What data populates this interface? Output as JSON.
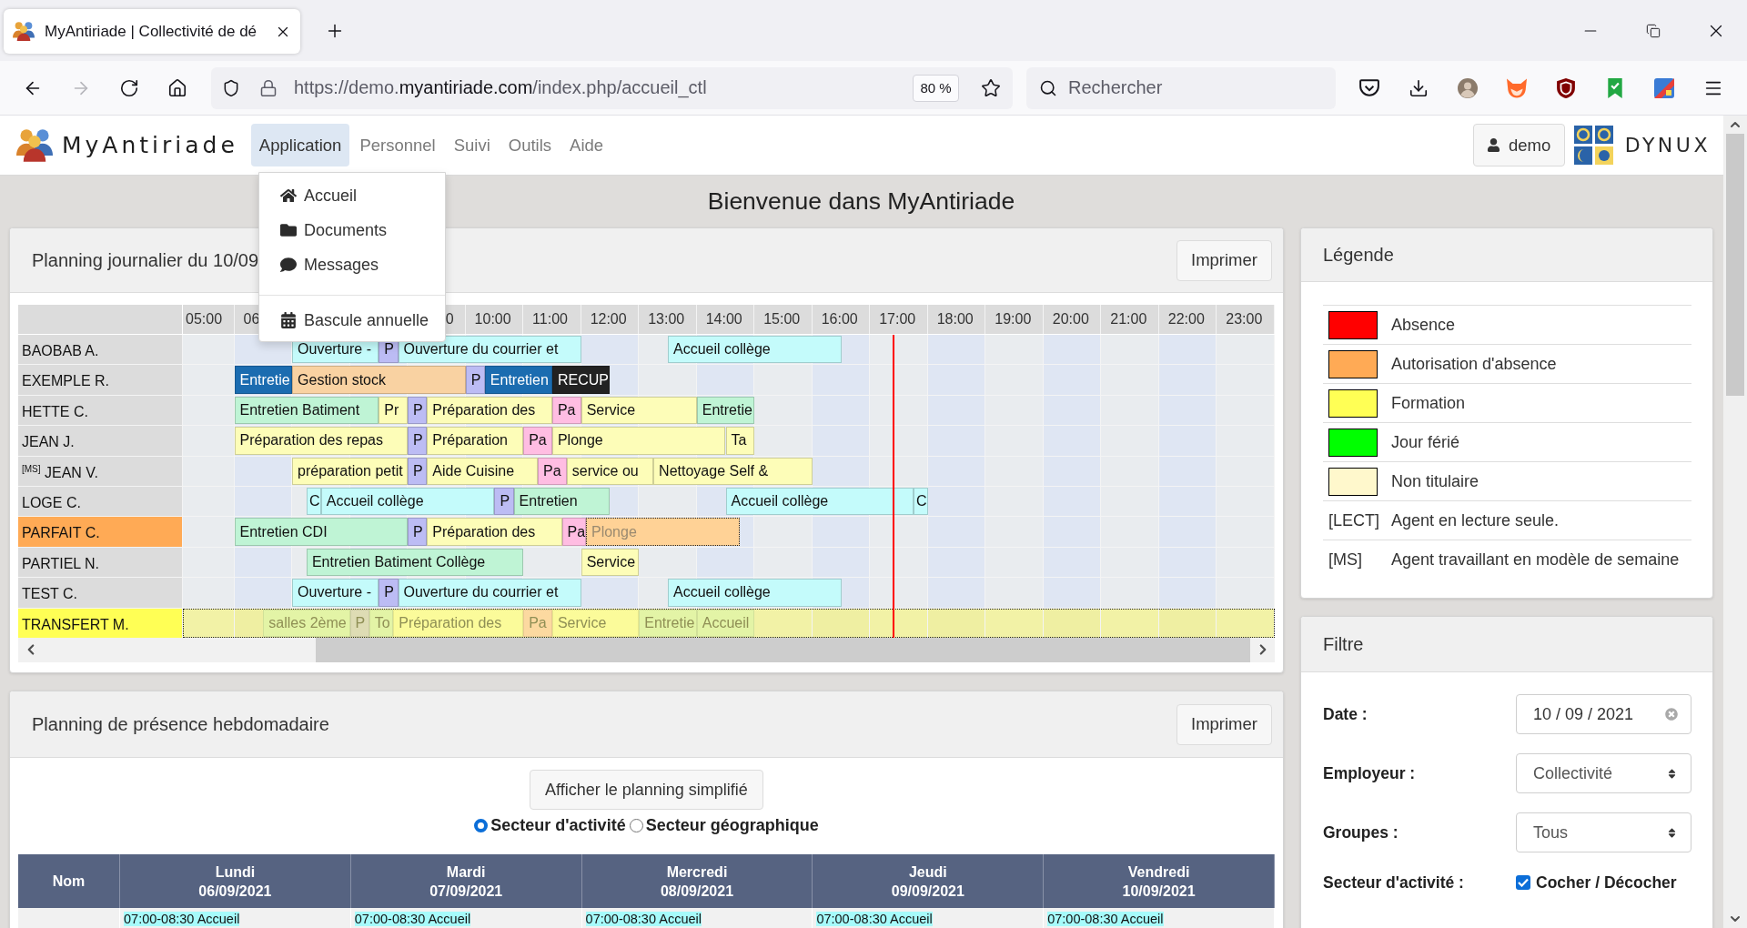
{
  "browser": {
    "tab": {
      "title": "MyAntiriade | Collectivité de dé",
      "selected": true
    },
    "history": {
      "back_disabled": false,
      "forward_disabled": true
    },
    "address": {
      "scheme": "https://demo.",
      "domain": "myantiriade.com",
      "path": "/index.php/accueil_ctl"
    },
    "zoom": "80 %",
    "search": {
      "placeholder": "Rechercher"
    }
  },
  "app": {
    "logo": "MyAntiriade",
    "menu": [
      {
        "label": "Application",
        "selected": true
      },
      {
        "label": "Personnel",
        "selected": false
      },
      {
        "label": "Suivi",
        "selected": false
      },
      {
        "label": "Outils",
        "selected": false
      },
      {
        "label": "Aide",
        "selected": false
      }
    ],
    "user": "demo",
    "partner_logo": "DYNUX",
    "dropdown": {
      "groups": [
        [
          {
            "label": "Accueil"
          },
          {
            "label": "Documents"
          },
          {
            "label": "Messages"
          }
        ],
        [
          {
            "label": "Bascule annuelle"
          }
        ]
      ]
    }
  },
  "heading": "Bienvenue dans MyAntiriade",
  "daily_planning": {
    "title": "Planning journalier du 10/09",
    "print_button": "Imprimer",
    "hour_labels": {
      "before_menu": [
        "05:00",
        "06"
      ],
      "after_menu": [
        "0",
        "10:00",
        "11:00",
        "12:00",
        "13:00",
        "14:00",
        "15:00",
        "16:00",
        "17:00",
        "18:00",
        "19:00",
        "20:00",
        "21:00",
        "22:00",
        "23:00"
      ]
    },
    "rows": [
      {
        "name": "BAOBAB A.",
        "faded": false,
        "events": [
          {
            "kind": "shift",
            "label": "Ouverture -",
            "color": "#c4fbfb"
          },
          {
            "kind": "shift",
            "label": "P",
            "color": "#bcbcf4"
          },
          {
            "kind": "shift",
            "label": "Ouverture du courrier et",
            "color": "#c4fbfb"
          },
          {
            "kind": "shift",
            "label": "Accueil collège",
            "color": "#c4fbfb"
          }
        ]
      },
      {
        "name": "EXEMPLE R.",
        "faded": false,
        "events": [
          {
            "kind": "shift",
            "label": "Entretie",
            "color": "#1b6cb0"
          },
          {
            "kind": "shift",
            "label": "Gestion stock",
            "color": "#f9d2a2"
          },
          {
            "kind": "shift",
            "label": "P",
            "color": "#bcbcf4"
          },
          {
            "kind": "shift",
            "label": "Entretien",
            "color": "#1b6cb0"
          },
          {
            "kind": "shift",
            "label": "RECUP",
            "color": "#222222"
          }
        ]
      },
      {
        "name": "HETTE C.",
        "faded": false,
        "events": [
          {
            "kind": "shift",
            "label": "Entretien Batiment",
            "color": "#bff4d5"
          },
          {
            "kind": "shift",
            "label": "Pr",
            "color": "#fdfdb8"
          },
          {
            "kind": "shift",
            "label": "P",
            "color": "#bcbcf4"
          },
          {
            "kind": "shift",
            "label": "Préparation des",
            "color": "#fdfdb8"
          },
          {
            "kind": "shift",
            "label": "Pa",
            "color": "#ffbde2"
          },
          {
            "kind": "shift",
            "label": "Service",
            "color": "#fdfdb8"
          },
          {
            "kind": "shift",
            "label": "Entretie",
            "color": "#bff4d5"
          }
        ]
      },
      {
        "name": "JEAN J.",
        "faded": false,
        "events": [
          {
            "kind": "shift",
            "label": "Préparation des repas",
            "color": "#fdfdb8"
          },
          {
            "kind": "shift",
            "label": "P",
            "color": "#bcbcf4"
          },
          {
            "kind": "shift",
            "label": "Préparation",
            "color": "#fdfdb8"
          },
          {
            "kind": "shift",
            "label": "Pa",
            "color": "#ffbde2"
          },
          {
            "kind": "shift",
            "label": "Plonge",
            "color": "#fdfdb8"
          },
          {
            "kind": "shift",
            "label": "Ta",
            "color": "#fdfdb8"
          }
        ]
      },
      {
        "name": "$^{[MS]}$ JEAN V.",
        "faded": false,
        "events": [
          {
            "kind": "shift",
            "label": "préparation petit",
            "color": "#fdfdb8"
          },
          {
            "kind": "shift",
            "label": "P",
            "color": "#bcbcf4"
          },
          {
            "kind": "shift",
            "label": "Aide Cuisine",
            "color": "#fdfdb8"
          },
          {
            "kind": "shift",
            "label": "Pa",
            "color": "#ffbde2"
          },
          {
            "kind": "shift",
            "label": "service ou",
            "color": "#fdfdb8"
          },
          {
            "kind": "shift",
            "label": "Nettoyage Self &",
            "color": "#fdfdb8"
          }
        ]
      },
      {
        "name": "LOGE C.",
        "faded": false,
        "events": [
          {
            "kind": "shift",
            "label": "C",
            "color": "#c4fbfb"
          },
          {
            "kind": "shift",
            "label": "Accueil collège",
            "color": "#c4fbfb"
          },
          {
            "kind": "shift",
            "label": "P",
            "color": "#bcbcf4"
          },
          {
            "kind": "shift",
            "label": "Entretien",
            "color": "#bff4d5"
          },
          {
            "kind": "shift",
            "label": "Accueil collège",
            "color": "#c4fbfb"
          },
          {
            "kind": "shift",
            "label": "C",
            "color": "#c4fbfb"
          }
        ]
      },
      {
        "name": "PARFAIT C.",
        "color": "#ffaa55",
        "faded": false,
        "events": [
          {
            "kind": "shift",
            "label": "Entretien CDI",
            "color": "#bff4d5"
          },
          {
            "kind": "shift",
            "label": "P",
            "color": "#bcbcf4"
          },
          {
            "kind": "shift",
            "label": "Préparation des",
            "color": "#fdfdb8"
          },
          {
            "kind": "shift",
            "label": "Pa",
            "color": "#ffbde2"
          },
          {
            "kind": "overlay",
            "label": "Plonge",
            "color": "#ffd296"
          }
        ]
      },
      {
        "name": "PARTIEL N.",
        "faded": false,
        "events": [
          {
            "kind": "shift",
            "label": "Entretien Batiment Collège",
            "color": "#bff4d5"
          },
          {
            "kind": "shift",
            "label": "Service",
            "color": "#fdfdb8"
          }
        ]
      },
      {
        "name": "TEST C.",
        "faded": false,
        "events": [
          {
            "kind": "shift",
            "label": "Ouverture -",
            "color": "#c4fbfb"
          },
          {
            "kind": "shift",
            "label": "P",
            "color": "#bcbcf4"
          },
          {
            "kind": "shift",
            "label": "Ouverture du courrier et",
            "color": "#c4fbfb"
          },
          {
            "kind": "shift",
            "label": "Accueil collège",
            "color": "#c4fbfb"
          }
        ]
      },
      {
        "name": "TRANSFERT M.",
        "color": "#ffff55",
        "faded": true,
        "events": [
          {
            "kind": "shift",
            "label": "salles 2ème",
            "color": "#e3f4a6"
          },
          {
            "kind": "shift",
            "label": "P",
            "color": "#dedcb4"
          },
          {
            "kind": "shift",
            "label": "To",
            "color": "#e3f4a6"
          },
          {
            "kind": "shift",
            "label": "Préparation des",
            "color": "#fbfb9a"
          },
          {
            "kind": "shift",
            "label": "Pa",
            "color": "#fcd9a0"
          },
          {
            "kind": "shift",
            "label": "Service",
            "color": "#fbfb9a"
          },
          {
            "kind": "shift",
            "label": "Entretie",
            "color": "#e3f4a6"
          },
          {
            "kind": "shift",
            "label": "Accueil",
            "color": "#e3f4a6"
          }
        ]
      }
    ]
  },
  "weekly_planning": {
    "title": "Planning de présence hebdomadaire",
    "print_button": "Imprimer",
    "simplified_button": "Afficher le planning simplifié",
    "sector_options": [
      {
        "label": "Secteur d'activité",
        "selected": true
      },
      {
        "label": "Secteur géographique",
        "selected": false
      }
    ],
    "name_column": "Nom",
    "days": [
      {
        "day": "Lundi",
        "date": "06/09/2021"
      },
      {
        "day": "Mardi",
        "date": "07/09/2021"
      },
      {
        "day": "Mercredi",
        "date": "08/09/2021"
      },
      {
        "day": "Jeudi",
        "date": "09/09/2021"
      },
      {
        "day": "Vendredi",
        "date": "10/09/2021"
      }
    ],
    "rows": [
      {
        "cells": [
          "07:00-08:30 Accueil",
          "07:00-08:30 Accueil",
          "07:00-08:30 Accueil",
          "07:00-08:30 Accueil",
          "07:00-08:30 Accueil"
        ]
      }
    ]
  },
  "legend": {
    "title": "Légende",
    "items": [
      {
        "kind": "swatch",
        "color": "#ff0000",
        "label": "Absence"
      },
      {
        "kind": "swatch",
        "color": "#ffaa55",
        "label": "Autorisation d'absence"
      },
      {
        "kind": "swatch",
        "color": "#ffff55",
        "label": "Formation"
      },
      {
        "kind": "swatch",
        "color": "#00ff00",
        "label": "Jour férié"
      },
      {
        "kind": "swatch",
        "color": "#fff8cc",
        "label": "Non titulaire"
      },
      {
        "kind": "tag",
        "tag": "[LECT]",
        "label": "Agent en lecture seule."
      },
      {
        "kind": "tag",
        "tag": "[MS]",
        "label": "Agent travaillant en modèle de semaine"
      }
    ]
  },
  "filter": {
    "title": "Filtre",
    "fields": [
      {
        "kind": "date",
        "label": "Date :",
        "value": "10 / 09 / 2021"
      },
      {
        "kind": "select",
        "label": "Employeur :",
        "value": "Collectivité"
      },
      {
        "kind": "select",
        "label": "Groupes :",
        "value": "Tous"
      },
      {
        "kind": "checkbox",
        "label": "Secteur d'activité :",
        "option": "Cocher / Décocher",
        "checked": true
      }
    ]
  }
}
